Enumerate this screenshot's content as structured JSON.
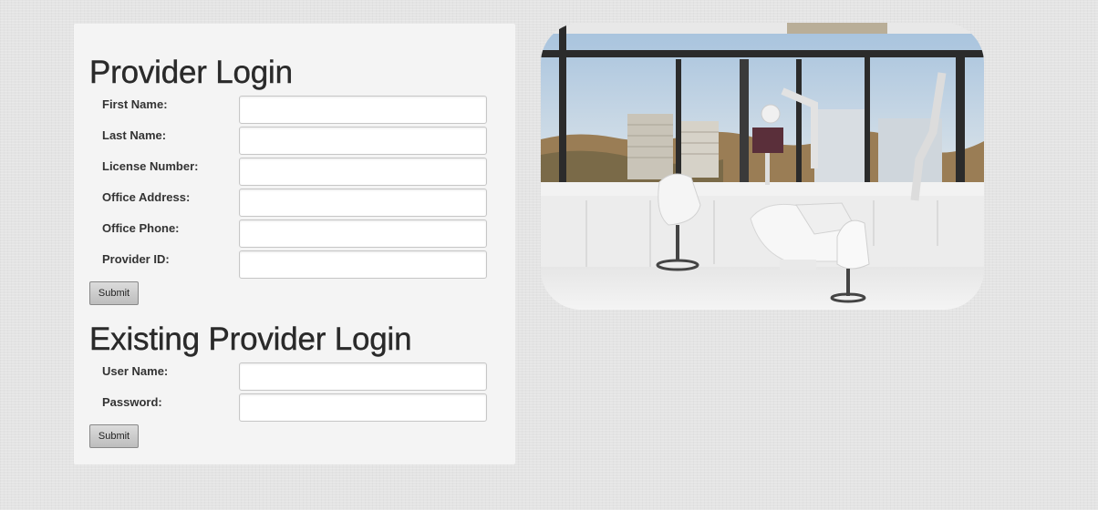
{
  "provider_login": {
    "heading": "Provider Login",
    "fields": [
      {
        "label": "First Name:",
        "value": ""
      },
      {
        "label": "Last Name:",
        "value": ""
      },
      {
        "label": "License Number:",
        "value": ""
      },
      {
        "label": "Office Address:",
        "value": ""
      },
      {
        "label": "Office Phone:",
        "value": ""
      },
      {
        "label": "Provider ID:",
        "value": ""
      }
    ],
    "submit_label": "Submit"
  },
  "existing_login": {
    "heading": "Existing Provider Login",
    "fields": [
      {
        "label": "User Name:",
        "value": ""
      },
      {
        "label": "Password:",
        "value": ""
      }
    ],
    "submit_label": "Submit"
  },
  "photo": {
    "subject": "dental-office-image"
  }
}
